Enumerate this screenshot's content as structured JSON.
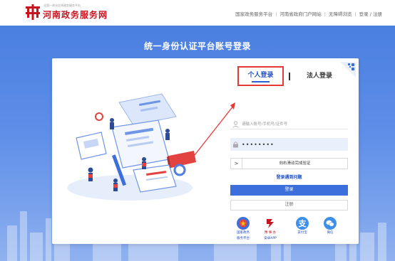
{
  "header": {
    "brand_sub": "全国一体化在线政务服务平台",
    "brand_title": "河南政务服务网",
    "nav": [
      "国家政务服务平台",
      "河南省政府门户网站",
      "无障碍浏览",
      "登录 / 注册"
    ],
    "nav_separator": "|"
  },
  "login": {
    "page_title": "统一身份认证平台账号登录",
    "tabs": {
      "personal": "个人登录",
      "legal": "法人登录"
    },
    "account_placeholder": "请输入账号/手机号/证件号",
    "password_value": "••••••••",
    "slider_handle": ">",
    "slider_text": "向右滑动完成验证",
    "trouble_link": "登录遇到问题",
    "login_button": "登录",
    "register_button": "注册",
    "alt_logins": [
      {
        "line1": "国家政务",
        "line2": "服务平台",
        "icon": "national-emblem-icon"
      },
      {
        "line1": "豫 事 办",
        "line2": "安卓APP",
        "icon": "yushiban-icon"
      },
      {
        "line1": "支付宝",
        "line2": "",
        "icon": "alipay-icon"
      },
      {
        "line1": "微信",
        "line2": "",
        "icon": "wechat-icon"
      }
    ]
  },
  "colors": {
    "brand_red": "#c8141f",
    "primary_blue": "#3d6fdc",
    "banner_blue": "#4b7fe0",
    "highlight_red": "#e53935"
  }
}
